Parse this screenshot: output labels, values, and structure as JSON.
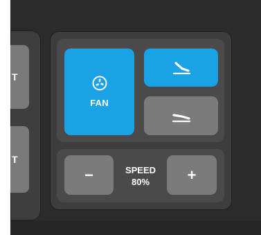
{
  "left_panel": {
    "buttons": [
      {
        "label": "T"
      },
      {
        "label": "T"
      }
    ]
  },
  "fan": {
    "label": "FAN",
    "icon": "fan-icon",
    "state": "active"
  },
  "positions": [
    {
      "icon": "recline-position-icon",
      "state": "active"
    },
    {
      "icon": "flat-position-icon",
      "state": "inactive"
    }
  ],
  "speed": {
    "label": "SPEED",
    "value": "80%",
    "minus_label": "−",
    "plus_label": "+"
  },
  "colors": {
    "active": "#1aa2e6",
    "inactive": "#7b7b7b",
    "panel": "#3d3d3d",
    "background": "#2b2b2b"
  }
}
